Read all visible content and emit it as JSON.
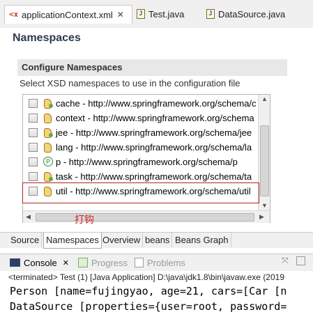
{
  "editor_tabs": [
    {
      "label": "applicationContext.xml",
      "close": "✕"
    },
    {
      "label": "Test.java"
    },
    {
      "label": "DataSource.java"
    }
  ],
  "page": {
    "title": "Namespaces",
    "section_title": "Configure Namespaces",
    "section_desc": "Select XSD namespaces to use in the configuration file"
  },
  "namespaces": [
    {
      "label": "cache - http://www.springframework.org/schema/c",
      "checked": false
    },
    {
      "label": "context - http://www.springframework.org/schema",
      "checked": false
    },
    {
      "label": "jee - http://www.springframework.org/schema/jee",
      "checked": false
    },
    {
      "label": "lang - http://www.springframework.org/schema/la",
      "checked": false
    },
    {
      "label": "p - http://www.springframework.org/schema/p",
      "checked": false
    },
    {
      "label": "task - http://www.springframework.org/schema/ta",
      "checked": false
    },
    {
      "label": "util - http://www.springframework.org/schema/util",
      "checked": false
    }
  ],
  "annotation": "打钩",
  "page_tabs": [
    "Source",
    "Namespaces",
    "Overview",
    "beans",
    "Beans Graph"
  ],
  "console": {
    "tabs": [
      "Console",
      "Progress",
      "Problems"
    ],
    "close": "✕",
    "info": "<terminated> Test (1) [Java Application] D:\\java\\jdk1.8\\bin\\javaw.exe (2019",
    "lines": [
      "Person [name=fujingyao, age=21, cars=[Car [n",
      "DataSource [properties={user=root, password="
    ]
  }
}
